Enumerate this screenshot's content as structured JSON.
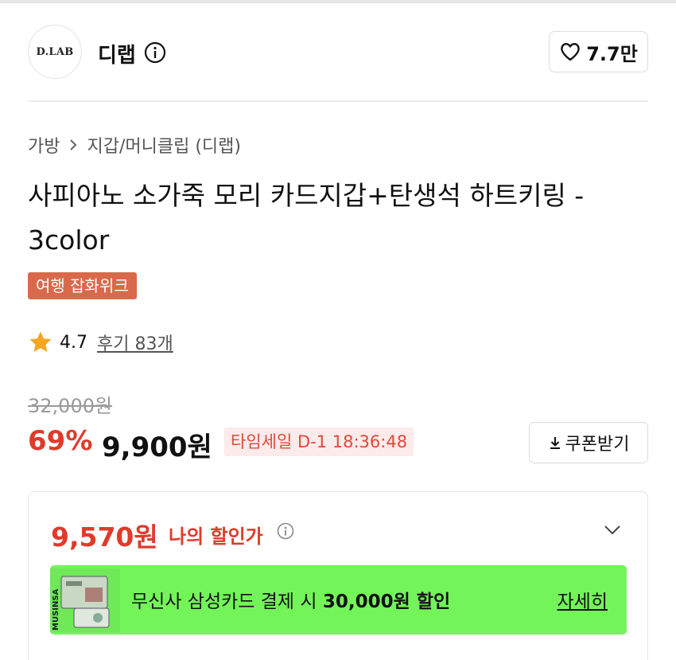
{
  "brand": {
    "logo_text": "D.LAB",
    "name": "디랩",
    "like_count": "7.7만"
  },
  "breadcrumb": {
    "category": "가방",
    "subcategory": "지갑/머니클립 (디랩)"
  },
  "product": {
    "title": "사피아노 소가죽 모리 카드지갑+탄생석 하트키링 - 3color",
    "tag": "여행 잡화위크",
    "rating": "4.7",
    "review_link": "후기 83개",
    "original_price": "32,000원",
    "discount_rate": "69%",
    "sale_price": "9,900원",
    "timesale": "타임세일 D-1 18:36:48",
    "coupon_button": "쿠폰받기"
  },
  "benefit": {
    "my_price": "9,570원",
    "my_price_label": "나의 할인가",
    "card_text_prefix": "무신사 삼성카드 결제 시 ",
    "card_text_amount": "30,000원 할인",
    "card_detail_link": "자세히",
    "card_thumb_text": "MUSINSA"
  },
  "colors": {
    "accent_red": "#e03a2b",
    "tag_bg": "#d9694b",
    "banner_green": "#73f55a",
    "star": "#f5a623"
  },
  "icons": [
    "info-icon",
    "heart-icon",
    "chevron-right-icon",
    "star-icon",
    "download-icon",
    "chevron-down-icon"
  ]
}
